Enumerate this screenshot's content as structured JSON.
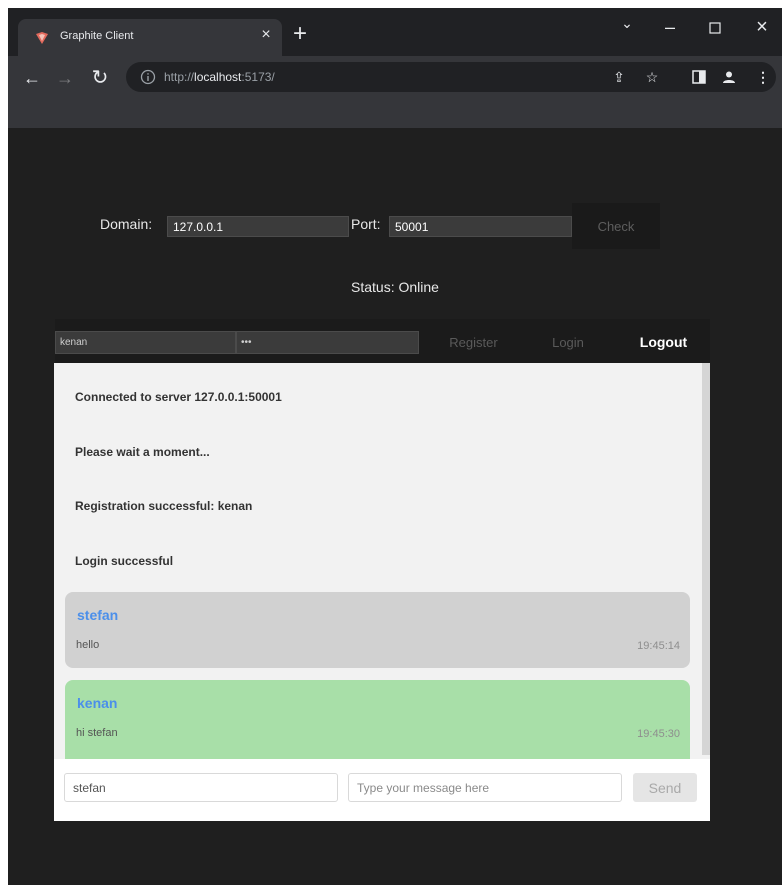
{
  "browser": {
    "tab_title": "Graphite Client",
    "tab_close": "×",
    "new_tab": "+",
    "url_scheme": "http://",
    "url_host": "localhost",
    "url_port_path": ":5173/",
    "icons": [
      "graphite-favicon-icon",
      "tab-search-icon",
      "minimize-icon",
      "maximize-icon",
      "close-icon",
      "back-arrow-icon",
      "forward-arrow-icon",
      "reload-icon",
      "info-icon",
      "share-icon",
      "star-icon",
      "side-panel-icon",
      "profile-icon",
      "kebab-menu-icon"
    ]
  },
  "server": {
    "domain_label": "Domain:",
    "domain_value": "127.0.0.1",
    "port_label": "Port:",
    "port_value": "50001",
    "check_label": "Check"
  },
  "status": {
    "text": "Status: Online"
  },
  "auth": {
    "username_value": "kenan",
    "password_value": "•••",
    "register_label": "Register",
    "login_label": "Login",
    "logout_label": "Logout"
  },
  "messages": {
    "system": [
      "Connected to server 127.0.0.1:50001",
      "Please wait a moment...",
      "Registration successful: kenan",
      "Login successful"
    ],
    "chat": [
      {
        "user": "stefan",
        "text": "hello",
        "time": "19:45:14",
        "color": "#d1d1d1"
      },
      {
        "user": "kenan",
        "text": "hi stefan",
        "time": "19:45:30",
        "color": "#a8dfa8"
      }
    ]
  },
  "composer": {
    "recipient_value": "stefan",
    "message_placeholder": "Type your message here",
    "send_label": "Send"
  },
  "colors": {
    "background": "#1f1f1f",
    "username_accent": "#4b8fea",
    "own_message": "#a8dfa8",
    "other_message": "#d1d1d1"
  }
}
